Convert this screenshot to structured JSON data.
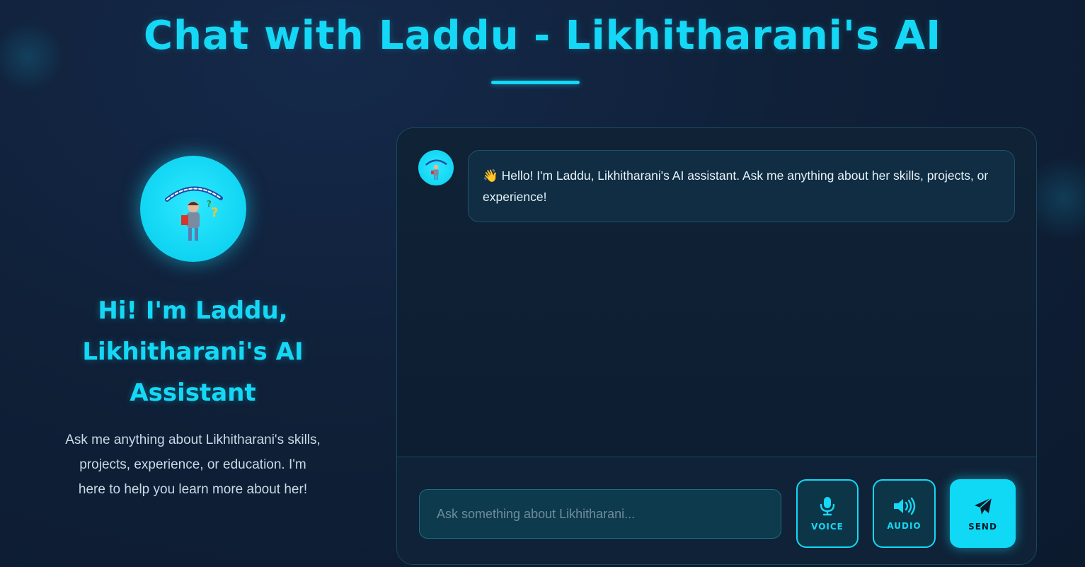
{
  "header": {
    "title": "Chat with Laddu - Likhitharani's AI"
  },
  "sidebar": {
    "heading": "Hi! I'm Laddu, Likhitharani's AI Assistant",
    "description": "Ask me anything about Likhitharani's skills, projects, experience, or education. I'm here to help you learn more about her!"
  },
  "chat": {
    "messages": [
      {
        "sender": "assistant",
        "emoji": "👋",
        "text": "Hello! I'm Laddu, Likhitharani's AI assistant. Ask me anything about her skills, projects, or experience!"
      }
    ],
    "input": {
      "placeholder": "Ask something about Likhitharani...",
      "value": ""
    },
    "buttons": {
      "voice_label": "VOICE",
      "audio_label": "AUDIO",
      "send_label": "SEND"
    }
  },
  "colors": {
    "accent": "#14d8f5",
    "background": "#0f2038",
    "panel_border": "#174a5e"
  },
  "icons": {
    "voice": "microphone-icon",
    "audio": "speaker-icon",
    "send": "paper-plane-icon"
  }
}
